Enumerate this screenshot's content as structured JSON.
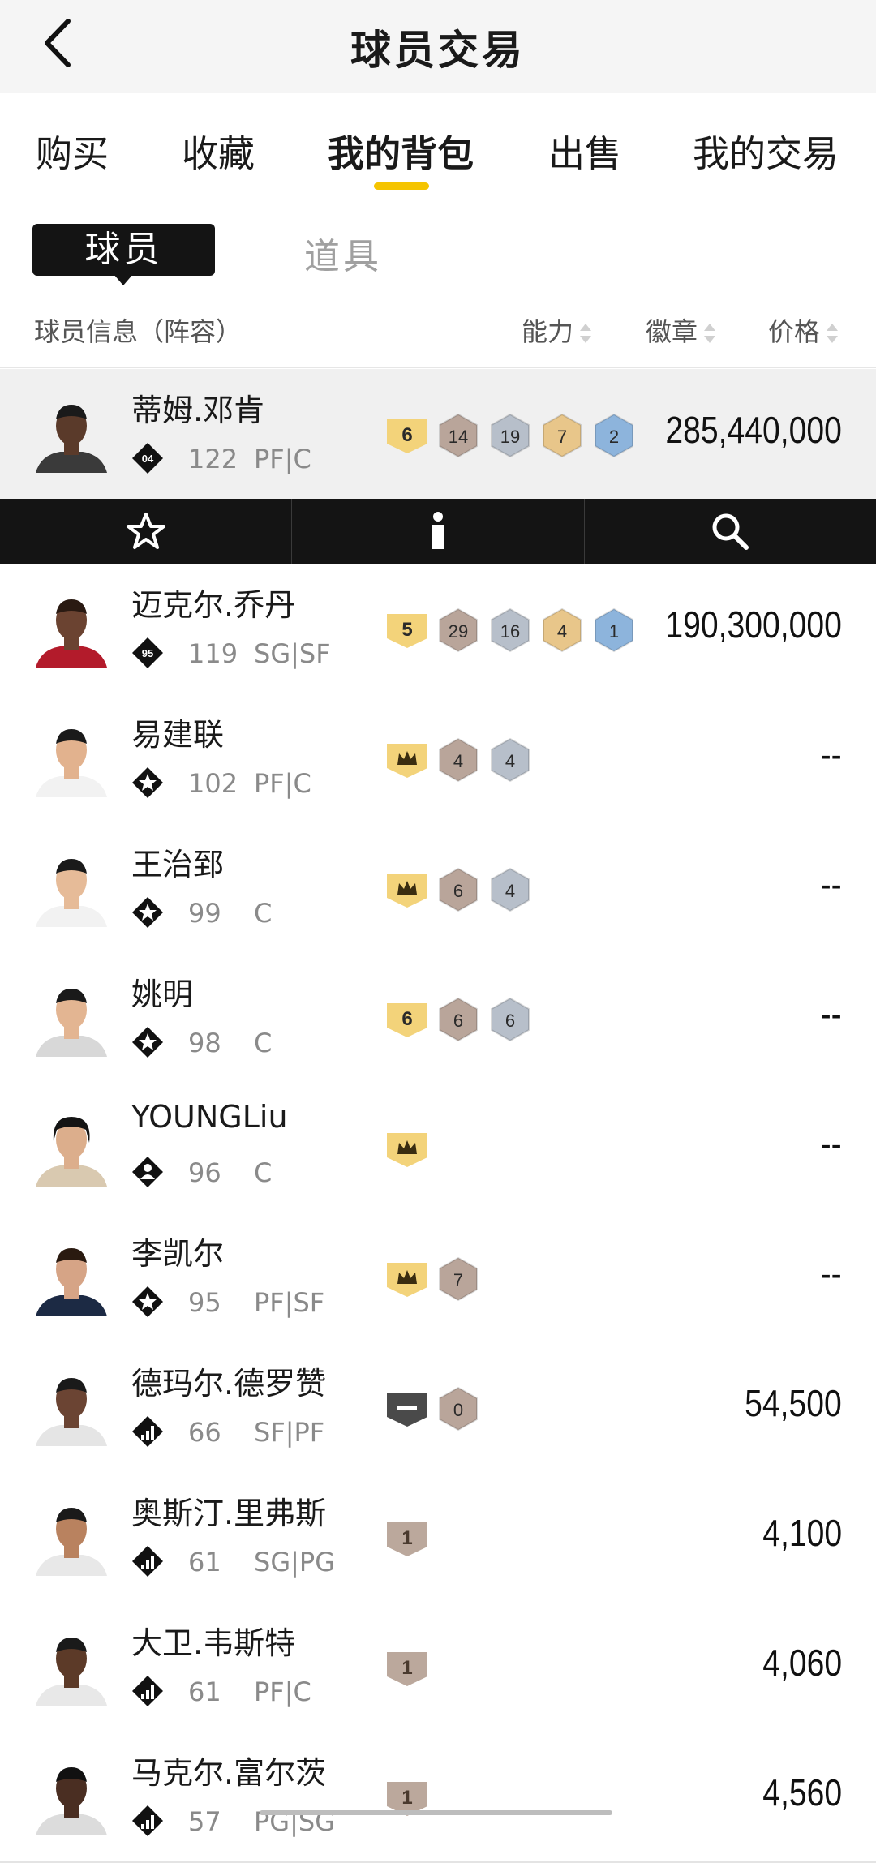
{
  "header": {
    "title": "球员交易"
  },
  "tabs": [
    {
      "label": "购买",
      "active": false
    },
    {
      "label": "收藏",
      "active": false
    },
    {
      "label": "我的背包",
      "active": true
    },
    {
      "label": "出售",
      "active": false
    },
    {
      "label": "我的交易",
      "active": false
    }
  ],
  "segment": {
    "players": "球员",
    "items": "道具"
  },
  "columns": {
    "info": "球员信息（阵容）",
    "ability": "能力",
    "badges": "徽章",
    "price": "价格"
  },
  "colors": {
    "accent": "#f5c400",
    "gold_badge": "#f3d37a",
    "bronze_badge": "#b9a59a",
    "silver_badge": "#b7bfca",
    "hof_badge": "#e8c68a",
    "blue_badge": "#8db4dc",
    "dark_bar": "#141414"
  },
  "action_bar": {
    "icons": [
      "star-icon",
      "info-icon",
      "search-icon"
    ]
  },
  "players": [
    {
      "name": "蒂姆.邓肯",
      "tier": "04",
      "rating": "122",
      "position": "PF|C",
      "price": "285,440,000",
      "badges": [
        {
          "kind": "gold",
          "text": "6"
        },
        {
          "kind": "bronze",
          "text": "14"
        },
        {
          "kind": "silver",
          "text": "19"
        },
        {
          "kind": "hof",
          "text": "7"
        },
        {
          "kind": "blue",
          "text": "2"
        }
      ],
      "selected": true
    },
    {
      "name": "迈克尔.乔丹",
      "tier": "95",
      "rating": "119",
      "position": "SG|SF",
      "price": "190,300,000",
      "badges": [
        {
          "kind": "gold",
          "text": "5"
        },
        {
          "kind": "bronze",
          "text": "29"
        },
        {
          "kind": "silver",
          "text": "16"
        },
        {
          "kind": "hof",
          "text": "4"
        },
        {
          "kind": "blue",
          "text": "1"
        }
      ]
    },
    {
      "name": "易建联",
      "tier": "star",
      "rating": "102",
      "position": "PF|C",
      "price": "--",
      "badges": [
        {
          "kind": "gold",
          "text": "crown"
        },
        {
          "kind": "bronze",
          "text": "4"
        },
        {
          "kind": "silver",
          "text": "4"
        }
      ]
    },
    {
      "name": "王治郅",
      "tier": "star",
      "rating": "99",
      "position": "C",
      "price": "--",
      "badges": [
        {
          "kind": "gold",
          "text": "crown"
        },
        {
          "kind": "bronze",
          "text": "6"
        },
        {
          "kind": "silver",
          "text": "4"
        }
      ]
    },
    {
      "name": "姚明",
      "tier": "star",
      "rating": "98",
      "position": "C",
      "price": "--",
      "badges": [
        {
          "kind": "gold",
          "text": "6"
        },
        {
          "kind": "bronze",
          "text": "6"
        },
        {
          "kind": "silver",
          "text": "6"
        }
      ]
    },
    {
      "name": "YOUNGLiu",
      "tier": "person",
      "rating": "96",
      "position": "C",
      "price": "--",
      "badges": [
        {
          "kind": "gold",
          "text": "crown"
        }
      ]
    },
    {
      "name": "李凯尔",
      "tier": "star",
      "rating": "95",
      "position": "PF|SF",
      "price": "--",
      "badges": [
        {
          "kind": "gold",
          "text": "crown"
        },
        {
          "kind": "bronze",
          "text": "7"
        }
      ]
    },
    {
      "name": "德玛尔.德罗赞",
      "tier": "bars",
      "rating": "66",
      "position": "SF|PF",
      "price": "54,500",
      "badges": [
        {
          "kind": "dark",
          "text": "minus"
        },
        {
          "kind": "bronze",
          "text": "0"
        }
      ]
    },
    {
      "name": "奥斯汀.里弗斯",
      "tier": "bars",
      "rating": "61",
      "position": "SG|PG",
      "price": "4,100",
      "badges": [
        {
          "kind": "tan",
          "text": "1"
        }
      ]
    },
    {
      "name": "大卫.韦斯特",
      "tier": "bars",
      "rating": "61",
      "position": "PF|C",
      "price": "4,060",
      "badges": [
        {
          "kind": "tan",
          "text": "1"
        }
      ]
    },
    {
      "name": "马克尔.富尔茨",
      "tier": "bars",
      "rating": "57",
      "position": "PG|SG",
      "price": "4,560",
      "badges": [
        {
          "kind": "tan",
          "text": "1"
        }
      ]
    }
  ]
}
